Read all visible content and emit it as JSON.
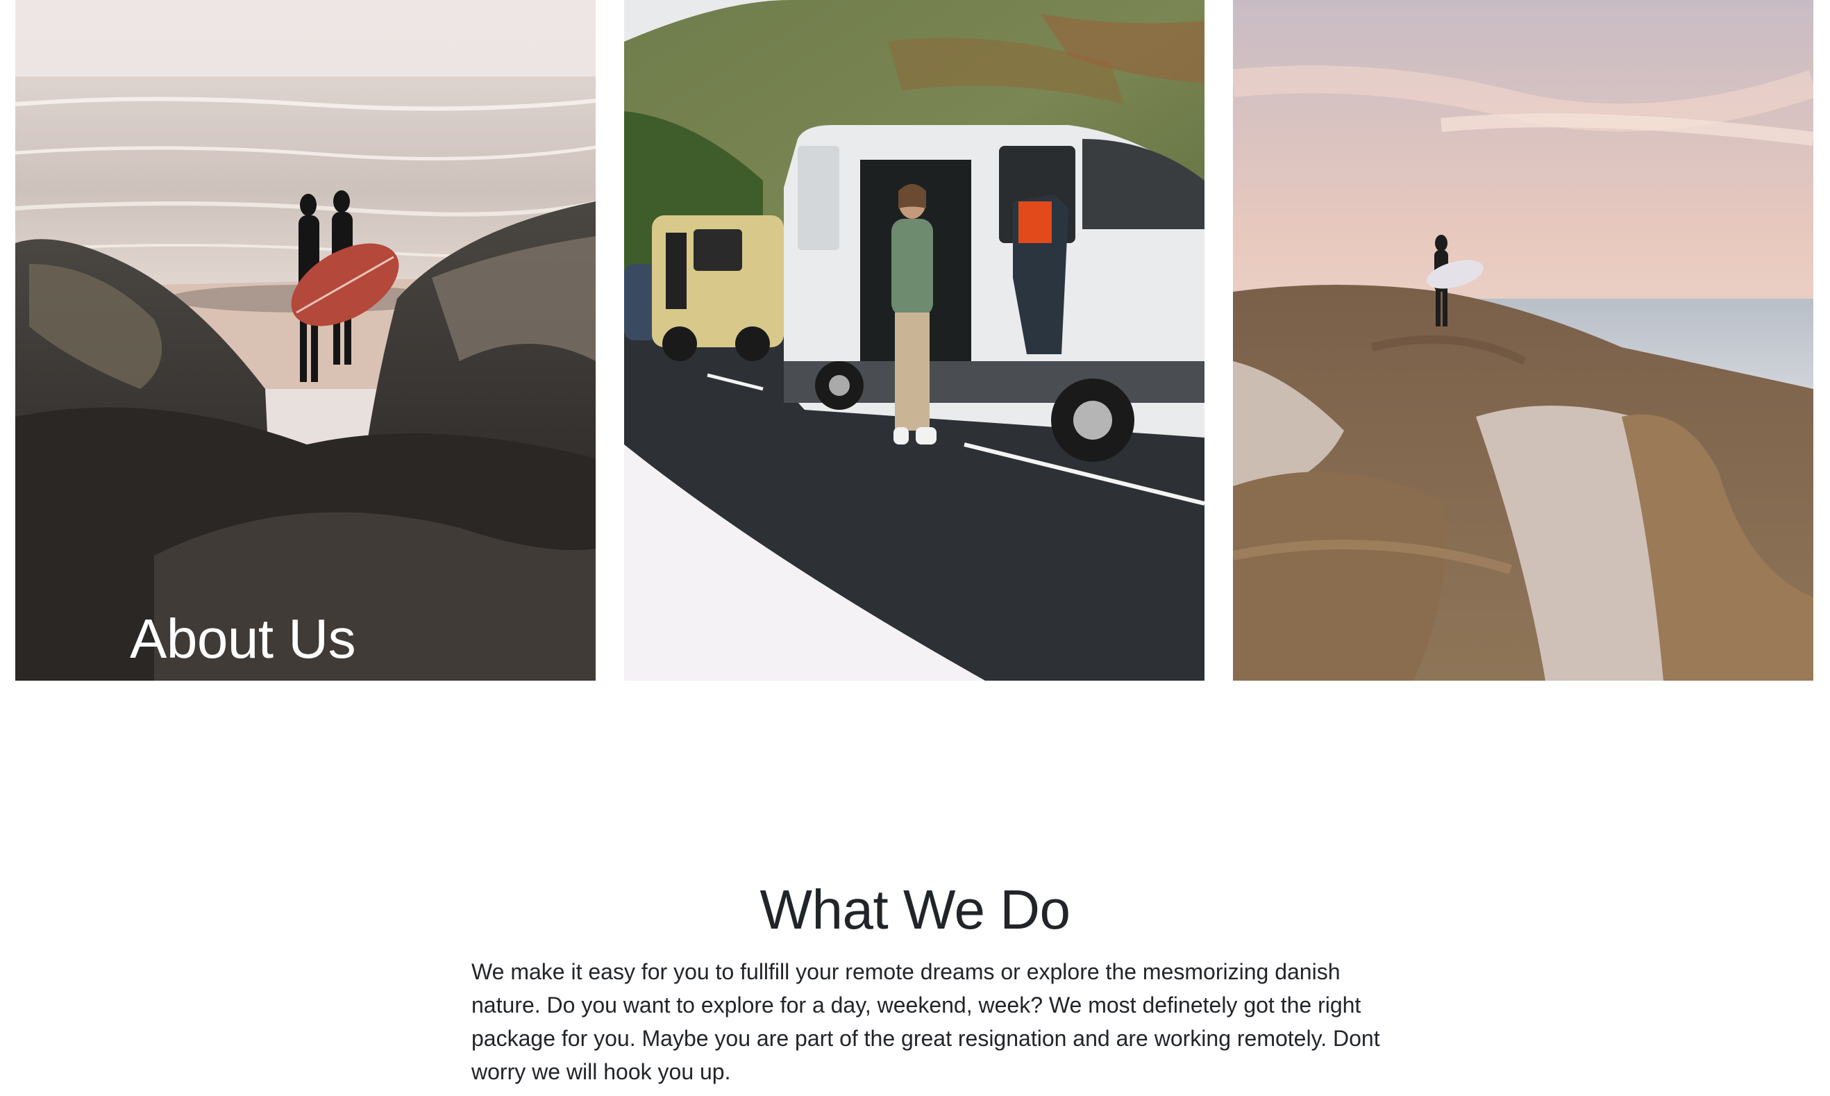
{
  "hero": {
    "title": "About Us"
  },
  "photos": [
    {
      "icon": "surfers-on-rocky-beach-photo"
    },
    {
      "icon": "camper-vans-on-coastal-road-photo"
    },
    {
      "icon": "surfer-on-sand-dunes-photo"
    }
  ],
  "what_we_do": {
    "title": "What We Do",
    "text": "We make it easy for you to fullfill your remote dreams or explore the mesmorizing danish nature. Do you want to explore for a day, weekend, week? We most definetely got the right package for you. Maybe you are part of the great resignation and are working remotely. Dont worry we will hook you up."
  },
  "colors": {
    "text": "#212529",
    "hero_text": "#ffffff",
    "background": "#ffffff"
  }
}
